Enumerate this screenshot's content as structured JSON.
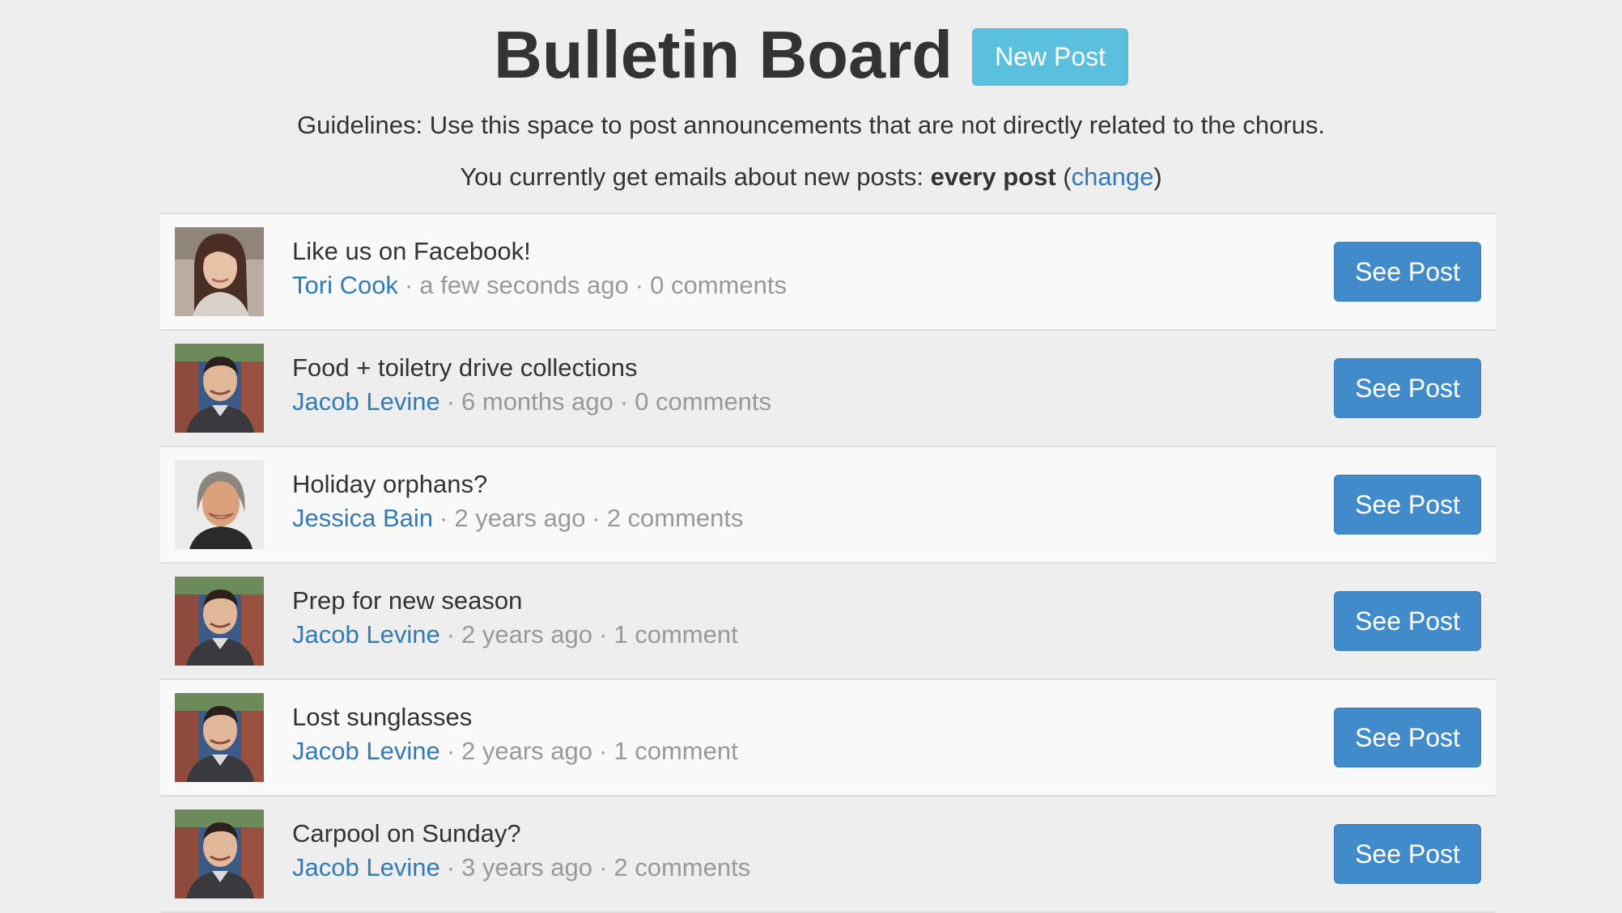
{
  "header": {
    "title": "Bulletin Board",
    "new_post_label": "New Post"
  },
  "guidelines": "Guidelines: Use this space to post announcements that are not directly related to the chorus.",
  "email_pref": {
    "prefix": "You currently get emails about new posts: ",
    "frequency": "every post",
    "open_paren": " (",
    "change_label": "change",
    "close_paren": ")"
  },
  "posts": [
    {
      "title": "Like us on Facebook!",
      "author": "Tori Cook",
      "time": "a few seconds ago",
      "comments": "0 comments",
      "avatar": "tori-cook",
      "button": "See Post"
    },
    {
      "title": "Food + toiletry drive collections",
      "author": "Jacob Levine",
      "time": "6 months ago",
      "comments": "0 comments",
      "avatar": "jacob-levine",
      "button": "See Post"
    },
    {
      "title": "Holiday orphans?",
      "author": "Jessica Bain",
      "time": "2 years ago",
      "comments": "2 comments",
      "avatar": "jessica-bain",
      "button": "See Post"
    },
    {
      "title": "Prep for new season",
      "author": "Jacob Levine",
      "time": "2 years ago",
      "comments": "1 comment",
      "avatar": "jacob-levine",
      "button": "See Post"
    },
    {
      "title": "Lost sunglasses",
      "author": "Jacob Levine",
      "time": "2 years ago",
      "comments": "1 comment",
      "avatar": "jacob-levine",
      "button": "See Post"
    },
    {
      "title": "Carpool on Sunday?",
      "author": "Jacob Levine",
      "time": "3 years ago",
      "comments": "2 comments",
      "avatar": "jacob-levine",
      "button": "See Post"
    }
  ],
  "meta_separator": "·",
  "colors": {
    "background": "#eeeeee",
    "row_alt": "#f9f9f9",
    "primary_button": "#428bca",
    "info_button": "#5bc0de",
    "link": "#337ab7",
    "muted_text": "#999999"
  }
}
